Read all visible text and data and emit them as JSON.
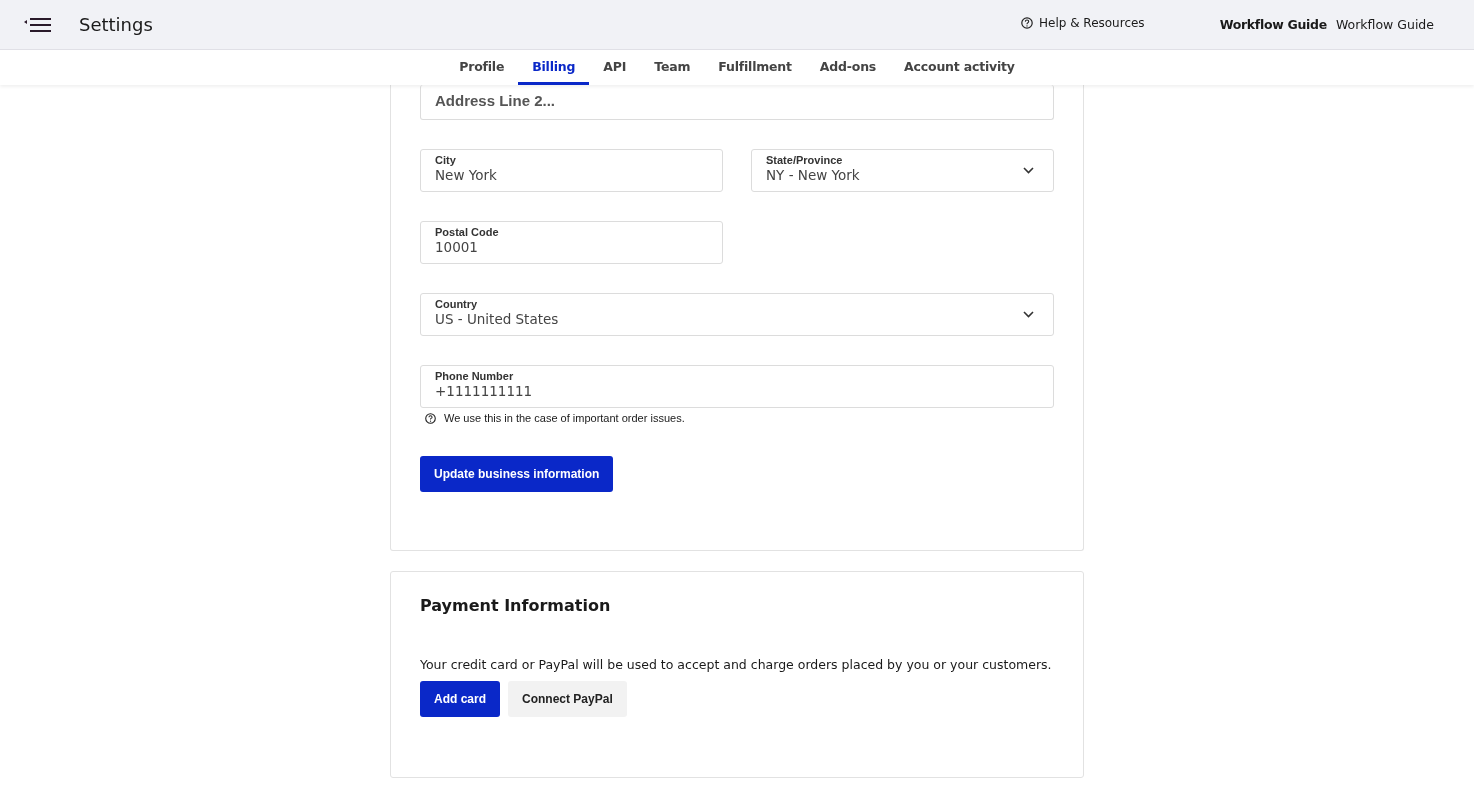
{
  "header": {
    "title": "Settings",
    "help": "Help & Resources",
    "guide_bold": "Workflow Guide",
    "guide": "Workflow Guide"
  },
  "tabs": [
    {
      "label": "Profile",
      "selected": false
    },
    {
      "label": "Billing",
      "selected": true
    },
    {
      "label": "API",
      "selected": false
    },
    {
      "label": "Team",
      "selected": false
    },
    {
      "label": "Fulfillment",
      "selected": false
    },
    {
      "label": "Add-ons",
      "selected": false
    },
    {
      "label": "Account activity",
      "selected": false
    }
  ],
  "address_form": {
    "rows": [
      [
        {
          "kind": "text",
          "placeholder": "Address Line 2..."
        }
      ],
      [
        {
          "kind": "text",
          "label": "City",
          "value": "New York"
        },
        {
          "kind": "select",
          "label": "State/Province",
          "value": "NY - New York"
        }
      ],
      [
        {
          "kind": "text",
          "label": "Postal Code",
          "value": "10001"
        },
        {
          "kind": "empty"
        }
      ],
      [
        {
          "kind": "select",
          "label": "Country",
          "value": "US - United States"
        }
      ],
      [
        {
          "kind": "text",
          "label": "Phone Number",
          "value": "+1111111111",
          "hint": "We use this in the case of important order issues."
        }
      ]
    ],
    "submit": "Update business information"
  },
  "payment": {
    "title": "Payment Information",
    "text": "Your credit card or PayPal will be used to accept and charge orders placed by you or your customers.",
    "buttons": [
      {
        "label": "Add card",
        "kind": "primary"
      },
      {
        "label": "Connect PayPal",
        "kind": "secondary"
      }
    ]
  }
}
